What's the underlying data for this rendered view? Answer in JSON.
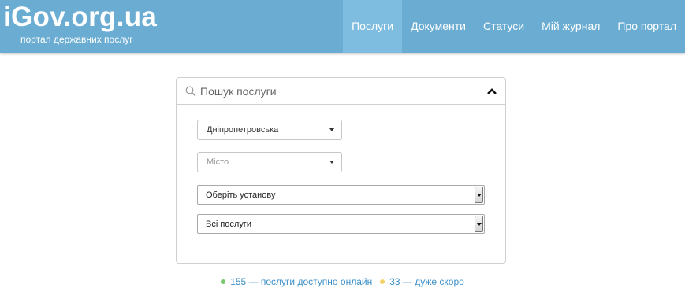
{
  "header": {
    "logo": "iGov.org.ua",
    "tagline": "портал державних послуг",
    "nav": [
      {
        "label": "Послуги",
        "active": true
      },
      {
        "label": "Документи",
        "active": false
      },
      {
        "label": "Статуси",
        "active": false
      },
      {
        "label": "Мій журнал",
        "active": false
      },
      {
        "label": "Про портал",
        "active": false
      }
    ],
    "colors": {
      "header_bg": "#6badd2",
      "nav_active_bg": "#7fbde0"
    }
  },
  "search": {
    "placeholder": "Пошук послуги",
    "icon": "search-icon",
    "toggle_icon": "chevron-up-icon"
  },
  "filters": {
    "region": {
      "value": "Дніпропетровська"
    },
    "city": {
      "placeholder": "Місто"
    },
    "institution": {
      "value": "Оберіть установу"
    },
    "services": {
      "value": "Всі послуги"
    }
  },
  "stats": {
    "online_text": "155 — послуги доступно онлайн",
    "soon_text": "33 — дуже скоро",
    "online_color": "#7bc96f",
    "soon_color": "#f5d36b"
  }
}
